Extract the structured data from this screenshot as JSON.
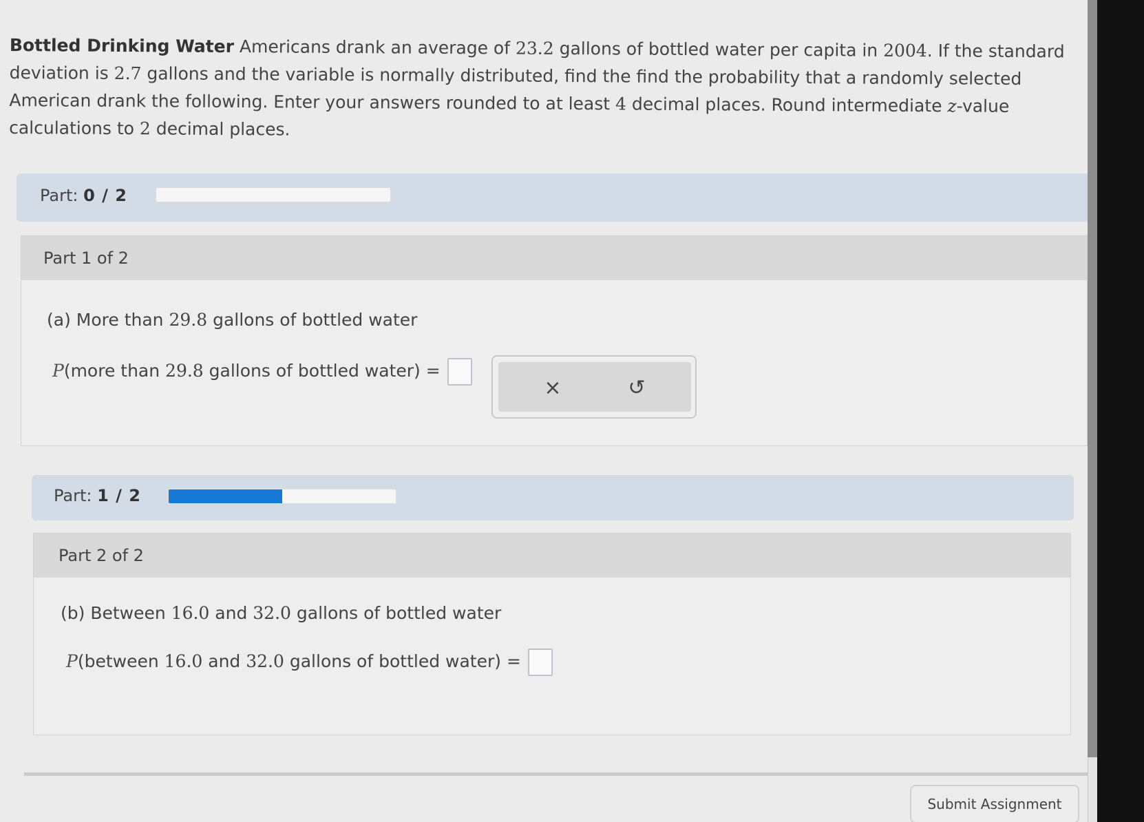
{
  "problem": {
    "title": "Bottled Drinking Water",
    "text_1": " Americans drank an average of ",
    "mean": "23.2",
    "text_2": " gallons of bottled water per capita in ",
    "year": "2004",
    "text_3": ". If the standard deviation is ",
    "sd": "2.7",
    "text_4": " gallons and the variable is normally distributed, find the find the probability that a randomly selected American drank the following. Enter your answers rounded to at least ",
    "decimals": "4",
    "text_5": " decimal places. Round intermediate ",
    "z": "z",
    "text_6": "-value calculations to ",
    "z_decimals": "2",
    "text_7": " decimal places."
  },
  "part_progress_1": {
    "label": "Part:",
    "value": "0 / 2",
    "progress": 0
  },
  "part_1": {
    "header": "Part 1 of 2",
    "question_prefix": "(a) More than ",
    "question_value": "29.8",
    "question_suffix": " gallons of bottled water",
    "expr_p": "P",
    "expr_open": "(more than ",
    "expr_value": "29.8",
    "expr_close": " gallons of bottled water)",
    "equals": " ="
  },
  "tools": {
    "clear_icon": "×",
    "undo_icon": "↺"
  },
  "part_progress_2": {
    "label": "Part:",
    "value": "1 / 2",
    "progress": 0.5
  },
  "part_2": {
    "header": "Part 2 of 2",
    "question_prefix": "(b) Between ",
    "low": "16.0",
    "question_mid": " and ",
    "high": "32.0",
    "question_suffix": " gallons of bottled water",
    "expr_p": "P",
    "expr_open": "(between ",
    "expr_low": "16.0",
    "expr_mid": " and ",
    "expr_high": "32.0",
    "expr_close": " gallons of bottled water)",
    "equals": " ="
  },
  "submit_label": "Submit Assignment"
}
